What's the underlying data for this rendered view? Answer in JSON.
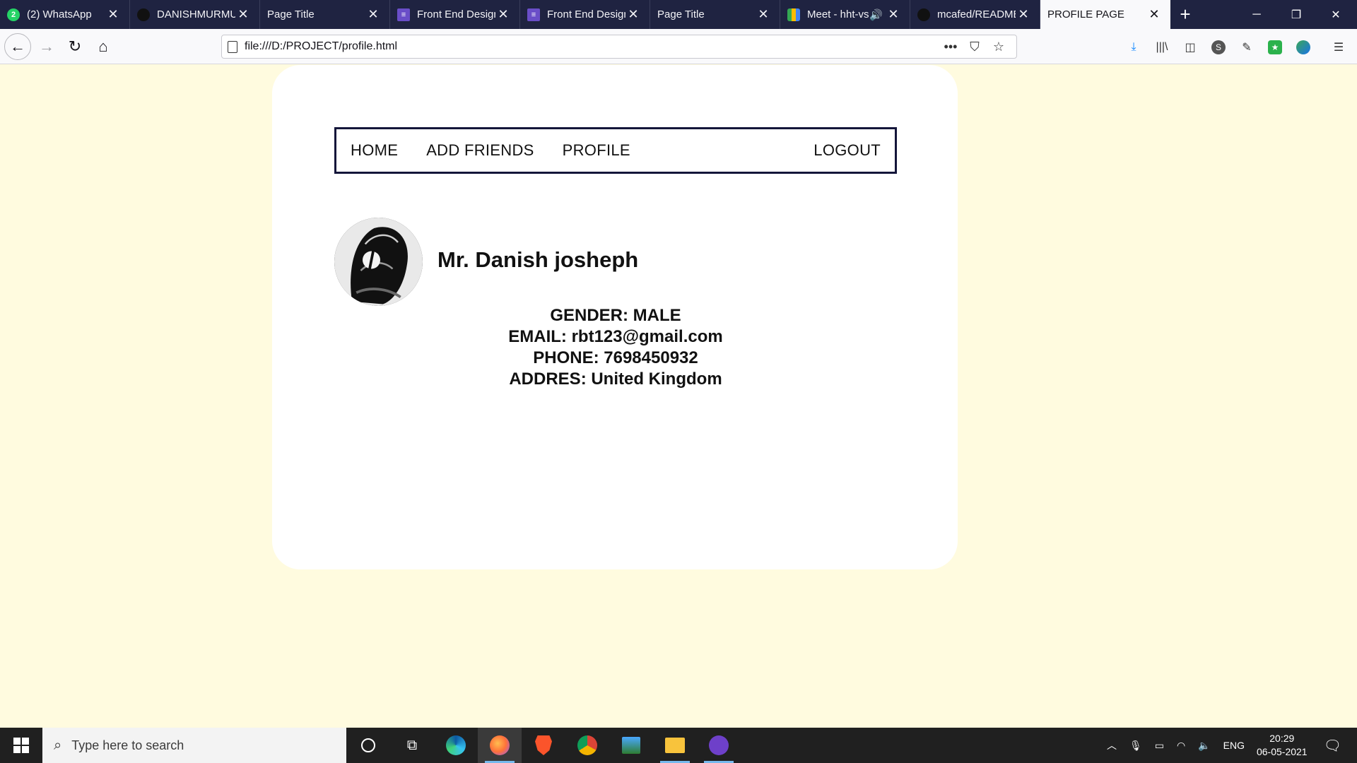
{
  "browser": {
    "tabs": [
      {
        "title": "(2) WhatsApp",
        "favicon": "whatsapp-icon",
        "badge": "2",
        "active": false
      },
      {
        "title": "DANISHMURMU",
        "favicon": "github-icon",
        "active": false
      },
      {
        "title": "Page Title",
        "favicon": "",
        "active": false
      },
      {
        "title": "Front End Design",
        "favicon": "forms-icon",
        "active": false
      },
      {
        "title": "Front End Design",
        "favicon": "forms-icon",
        "active": false
      },
      {
        "title": "Page Title",
        "favicon": "",
        "active": false
      },
      {
        "title": "Meet - hht-vs",
        "favicon": "meet-icon",
        "audio": true,
        "active": false
      },
      {
        "title": "mcafed/README",
        "favicon": "github-icon",
        "active": false
      },
      {
        "title": "PROFILE PAGE",
        "favicon": "",
        "active": true
      }
    ],
    "url": "file:///D:/PROJECT/profile.html"
  },
  "page": {
    "nav": {
      "home": "HOME",
      "add_friends": "ADD FRIENDS",
      "profile": "PROFILE",
      "logout": "LOGOUT"
    },
    "profile": {
      "name": "Mr. Danish josheph",
      "gender": "GENDER: MALE",
      "email": "EMAIL: rbt123@gmail.com",
      "phone": "PHONE: 7698450932",
      "address": "ADDRES: United Kingdom"
    },
    "colors": {
      "page_background": "#fffbdf",
      "card_background": "#ffffff",
      "nav_border": "#14163a"
    }
  },
  "taskbar": {
    "search_placeholder": "Type here to search",
    "language": "ENG",
    "time": "20:29",
    "date": "06-05-2021"
  }
}
